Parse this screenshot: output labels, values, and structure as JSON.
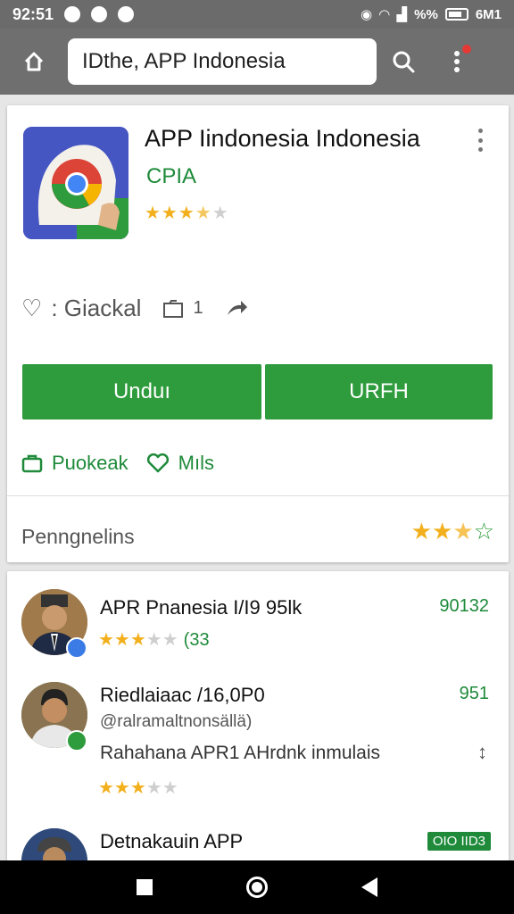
{
  "status_bar": {
    "time": "92:51",
    "right_text": "%%",
    "right_time": "6M1"
  },
  "toolbar": {
    "search_text": "IDthe, APP Indonesia"
  },
  "app": {
    "title": "APP Iindonesia Indonesia",
    "developer": "CPIA",
    "rating_stars": 3.5,
    "meta_text": ": Giackal",
    "meta_count": "1",
    "install_label": "Unduı",
    "second_label": "URFH",
    "link_left": "Puokeak",
    "link_right": "Mıls",
    "rating_label": "Penngnelins",
    "rating_summary_stars": 2.5
  },
  "reviews": [
    {
      "name": "APR Pnanesia I/I9 95lk",
      "count": "90132",
      "stars": 3,
      "extra": "(33"
    },
    {
      "name": "Riedlaiaac /16,0P0",
      "count": "951",
      "handle": "@ralramaltnonsällä)",
      "text": "Rahahana APR1 AHrdnk inmulais",
      "stars": 3
    },
    {
      "name": "Detnakauin APP",
      "badge": "OIO IID3"
    }
  ],
  "colors": {
    "accent_green": "#2e9b3c",
    "star_yellow": "#f2b01e",
    "toolbar_gray": "#6f6f6f"
  }
}
